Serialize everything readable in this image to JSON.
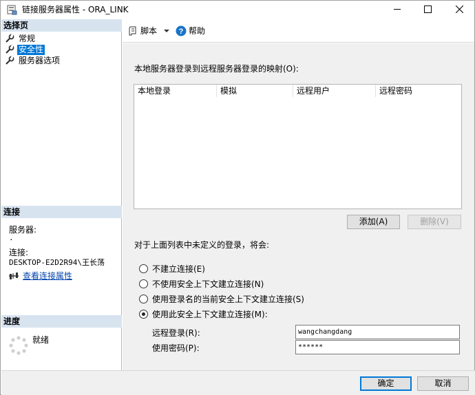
{
  "window": {
    "title": "链接服务器属性 - ORA_LINK"
  },
  "sidebar": {
    "select_page_header": "选择页",
    "pages": [
      {
        "label": "常规",
        "selected": false
      },
      {
        "label": "安全性",
        "selected": true
      },
      {
        "label": "服务器选项",
        "selected": false
      }
    ],
    "connection_header": "连接",
    "server_label": "服务器:",
    "server_value": ".",
    "connection_label": "连接:",
    "connection_value": "DESKTOP-E2D2R94\\王长荡",
    "view_connection_properties": "查看连接属性",
    "progress_header": "进度",
    "progress_status": "就绪"
  },
  "toolbar": {
    "script_label": "脚本",
    "help_label": "帮助"
  },
  "main": {
    "mapping_label": "本地服务器登录到远程服务器登录的映射(O):",
    "grid_columns": [
      "本地登录",
      "模拟",
      "远程用户",
      "远程密码"
    ],
    "add_button": "添加(A)",
    "delete_button": "删除(V)",
    "undefined_logins_label": "对于上面列表中未定义的登录，将会:",
    "radio_options": [
      {
        "label": "不建立连接(E)",
        "checked": false
      },
      {
        "label": "不使用安全上下文建立连接(N)",
        "checked": false
      },
      {
        "label": "使用登录名的当前安全上下文建立连接(S)",
        "checked": false
      },
      {
        "label": "使用此安全上下文建立连接(M):",
        "checked": true
      }
    ],
    "remote_login_label": "远程登录(R):",
    "remote_login_value": "wangchangdang",
    "password_label": "使用密码(P):",
    "password_value": "******"
  },
  "footer": {
    "ok_button": "确定",
    "cancel_button": "取消"
  },
  "colors": {
    "section_header_bg": "#d8e3f0",
    "selection_bg": "#0078d7",
    "content_bg": "#f0f0f0",
    "link": "#0645ad",
    "help_icon": "#1a73c7"
  }
}
